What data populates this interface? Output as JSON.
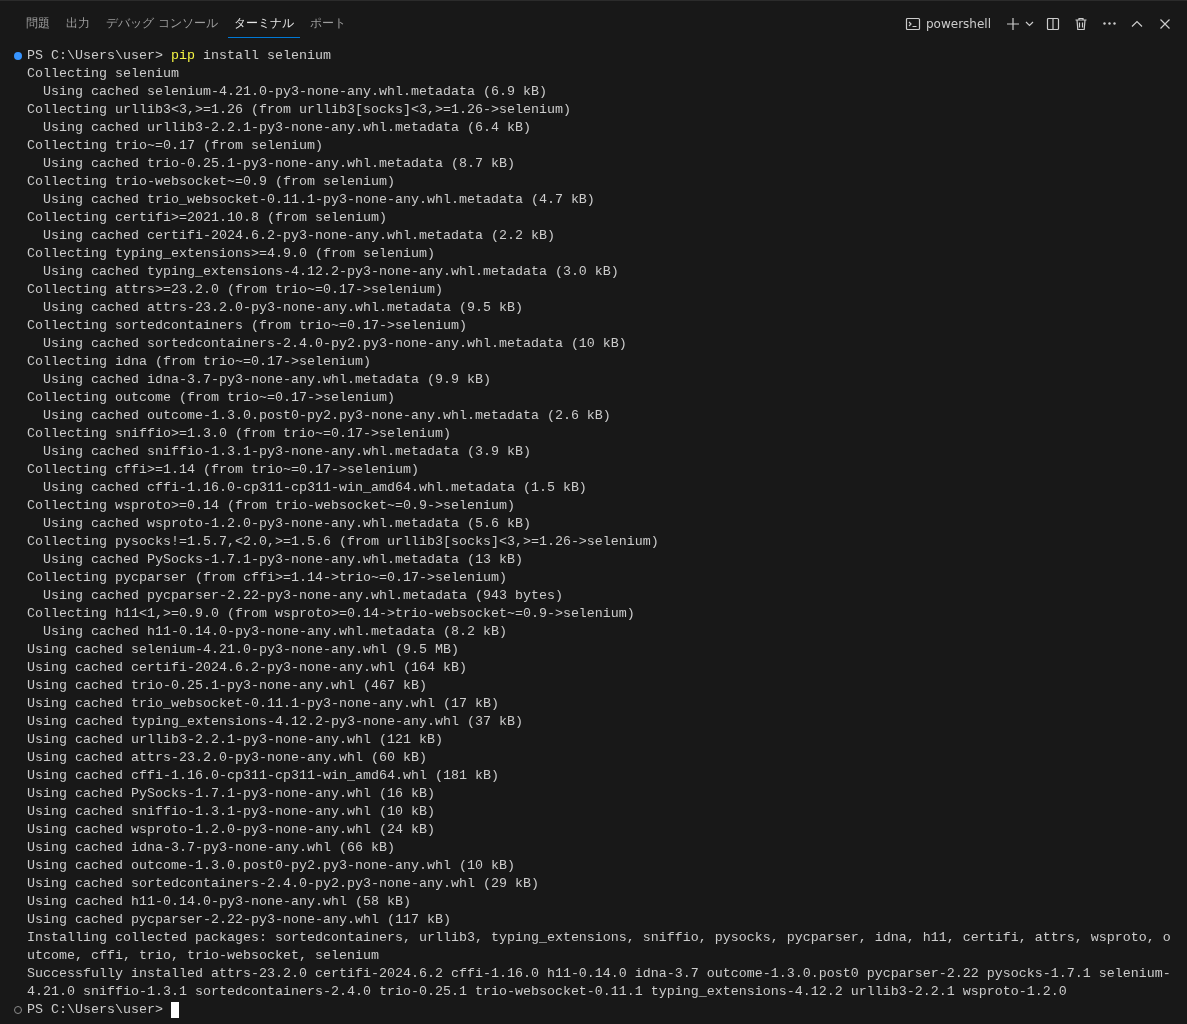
{
  "tabs": [
    {
      "label": "問題",
      "selected": false
    },
    {
      "label": "出力",
      "selected": false
    },
    {
      "label": "デバッグ コンソール",
      "selected": false
    },
    {
      "label": "ターミナル",
      "selected": true
    },
    {
      "label": "ポート",
      "selected": false
    }
  ],
  "terminal_profile": "powershell",
  "lines": [
    {
      "kind": "prompt",
      "succeeded": true,
      "prompt": "PS C:\\Users\\user> ",
      "command": "pip",
      "args": " install selenium"
    },
    {
      "kind": "output",
      "text": "Collecting selenium"
    },
    {
      "kind": "output",
      "text": "  Using cached selenium-4.21.0-py3-none-any.whl.metadata (6.9 kB)"
    },
    {
      "kind": "output",
      "text": "Collecting urllib3<3,>=1.26 (from urllib3[socks]<3,>=1.26->selenium)"
    },
    {
      "kind": "output",
      "text": "  Using cached urllib3-2.2.1-py3-none-any.whl.metadata (6.4 kB)"
    },
    {
      "kind": "output",
      "text": "Collecting trio~=0.17 (from selenium)"
    },
    {
      "kind": "output",
      "text": "  Using cached trio-0.25.1-py3-none-any.whl.metadata (8.7 kB)"
    },
    {
      "kind": "output",
      "text": "Collecting trio-websocket~=0.9 (from selenium)"
    },
    {
      "kind": "output",
      "text": "  Using cached trio_websocket-0.11.1-py3-none-any.whl.metadata (4.7 kB)"
    },
    {
      "kind": "output",
      "text": "Collecting certifi>=2021.10.8 (from selenium)"
    },
    {
      "kind": "output",
      "text": "  Using cached certifi-2024.6.2-py3-none-any.whl.metadata (2.2 kB)"
    },
    {
      "kind": "output",
      "text": "Collecting typing_extensions>=4.9.0 (from selenium)"
    },
    {
      "kind": "output",
      "text": "  Using cached typing_extensions-4.12.2-py3-none-any.whl.metadata (3.0 kB)"
    },
    {
      "kind": "output",
      "text": "Collecting attrs>=23.2.0 (from trio~=0.17->selenium)"
    },
    {
      "kind": "output",
      "text": "  Using cached attrs-23.2.0-py3-none-any.whl.metadata (9.5 kB)"
    },
    {
      "kind": "output",
      "text": "Collecting sortedcontainers (from trio~=0.17->selenium)"
    },
    {
      "kind": "output",
      "text": "  Using cached sortedcontainers-2.4.0-py2.py3-none-any.whl.metadata (10 kB)"
    },
    {
      "kind": "output",
      "text": "Collecting idna (from trio~=0.17->selenium)"
    },
    {
      "kind": "output",
      "text": "  Using cached idna-3.7-py3-none-any.whl.metadata (9.9 kB)"
    },
    {
      "kind": "output",
      "text": "Collecting outcome (from trio~=0.17->selenium)"
    },
    {
      "kind": "output",
      "text": "  Using cached outcome-1.3.0.post0-py2.py3-none-any.whl.metadata (2.6 kB)"
    },
    {
      "kind": "output",
      "text": "Collecting sniffio>=1.3.0 (from trio~=0.17->selenium)"
    },
    {
      "kind": "output",
      "text": "  Using cached sniffio-1.3.1-py3-none-any.whl.metadata (3.9 kB)"
    },
    {
      "kind": "output",
      "text": "Collecting cffi>=1.14 (from trio~=0.17->selenium)"
    },
    {
      "kind": "output",
      "text": "  Using cached cffi-1.16.0-cp311-cp311-win_amd64.whl.metadata (1.5 kB)"
    },
    {
      "kind": "output",
      "text": "Collecting wsproto>=0.14 (from trio-websocket~=0.9->selenium)"
    },
    {
      "kind": "output",
      "text": "  Using cached wsproto-1.2.0-py3-none-any.whl.metadata (5.6 kB)"
    },
    {
      "kind": "output",
      "text": "Collecting pysocks!=1.5.7,<2.0,>=1.5.6 (from urllib3[socks]<3,>=1.26->selenium)"
    },
    {
      "kind": "output",
      "text": "  Using cached PySocks-1.7.1-py3-none-any.whl.metadata (13 kB)"
    },
    {
      "kind": "output",
      "text": "Collecting pycparser (from cffi>=1.14->trio~=0.17->selenium)"
    },
    {
      "kind": "output",
      "text": "  Using cached pycparser-2.22-py3-none-any.whl.metadata (943 bytes)"
    },
    {
      "kind": "output",
      "text": "Collecting h11<1,>=0.9.0 (from wsproto>=0.14->trio-websocket~=0.9->selenium)"
    },
    {
      "kind": "output",
      "text": "  Using cached h11-0.14.0-py3-none-any.whl.metadata (8.2 kB)"
    },
    {
      "kind": "output",
      "text": "Using cached selenium-4.21.0-py3-none-any.whl (9.5 MB)"
    },
    {
      "kind": "output",
      "text": "Using cached certifi-2024.6.2-py3-none-any.whl (164 kB)"
    },
    {
      "kind": "output",
      "text": "Using cached trio-0.25.1-py3-none-any.whl (467 kB)"
    },
    {
      "kind": "output",
      "text": "Using cached trio_websocket-0.11.1-py3-none-any.whl (17 kB)"
    },
    {
      "kind": "output",
      "text": "Using cached typing_extensions-4.12.2-py3-none-any.whl (37 kB)"
    },
    {
      "kind": "output",
      "text": "Using cached urllib3-2.2.1-py3-none-any.whl (121 kB)"
    },
    {
      "kind": "output",
      "text": "Using cached attrs-23.2.0-py3-none-any.whl (60 kB)"
    },
    {
      "kind": "output",
      "text": "Using cached cffi-1.16.0-cp311-cp311-win_amd64.whl (181 kB)"
    },
    {
      "kind": "output",
      "text": "Using cached PySocks-1.7.1-py3-none-any.whl (16 kB)"
    },
    {
      "kind": "output",
      "text": "Using cached sniffio-1.3.1-py3-none-any.whl (10 kB)"
    },
    {
      "kind": "output",
      "text": "Using cached wsproto-1.2.0-py3-none-any.whl (24 kB)"
    },
    {
      "kind": "output",
      "text": "Using cached idna-3.7-py3-none-any.whl (66 kB)"
    },
    {
      "kind": "output",
      "text": "Using cached outcome-1.3.0.post0-py2.py3-none-any.whl (10 kB)"
    },
    {
      "kind": "output",
      "text": "Using cached sortedcontainers-2.4.0-py2.py3-none-any.whl (29 kB)"
    },
    {
      "kind": "output",
      "text": "Using cached h11-0.14.0-py3-none-any.whl (58 kB)"
    },
    {
      "kind": "output",
      "text": "Using cached pycparser-2.22-py3-none-any.whl (117 kB)"
    },
    {
      "kind": "output",
      "text": "Installing collected packages: sortedcontainers, urllib3, typing_extensions, sniffio, pysocks, pycparser, idna, h11, certifi, attrs, wsproto, o"
    },
    {
      "kind": "output",
      "text": "utcome, cffi, trio, trio-websocket, selenium"
    },
    {
      "kind": "output",
      "text": "Successfully installed attrs-23.2.0 certifi-2024.6.2 cffi-1.16.0 h11-0.14.0 idna-3.7 outcome-1.3.0.post0 pycparser-2.22 pysocks-1.7.1 selenium-"
    },
    {
      "kind": "output",
      "text": "4.21.0 sniffio-1.3.1 sortedcontainers-2.4.0 trio-0.25.1 trio-websocket-0.11.1 typing_extensions-4.12.2 urllib3-2.2.1 wsproto-1.2.0"
    },
    {
      "kind": "prompt",
      "succeeded": false,
      "prompt": "PS C:\\Users\\user> ",
      "cursor": true
    }
  ]
}
